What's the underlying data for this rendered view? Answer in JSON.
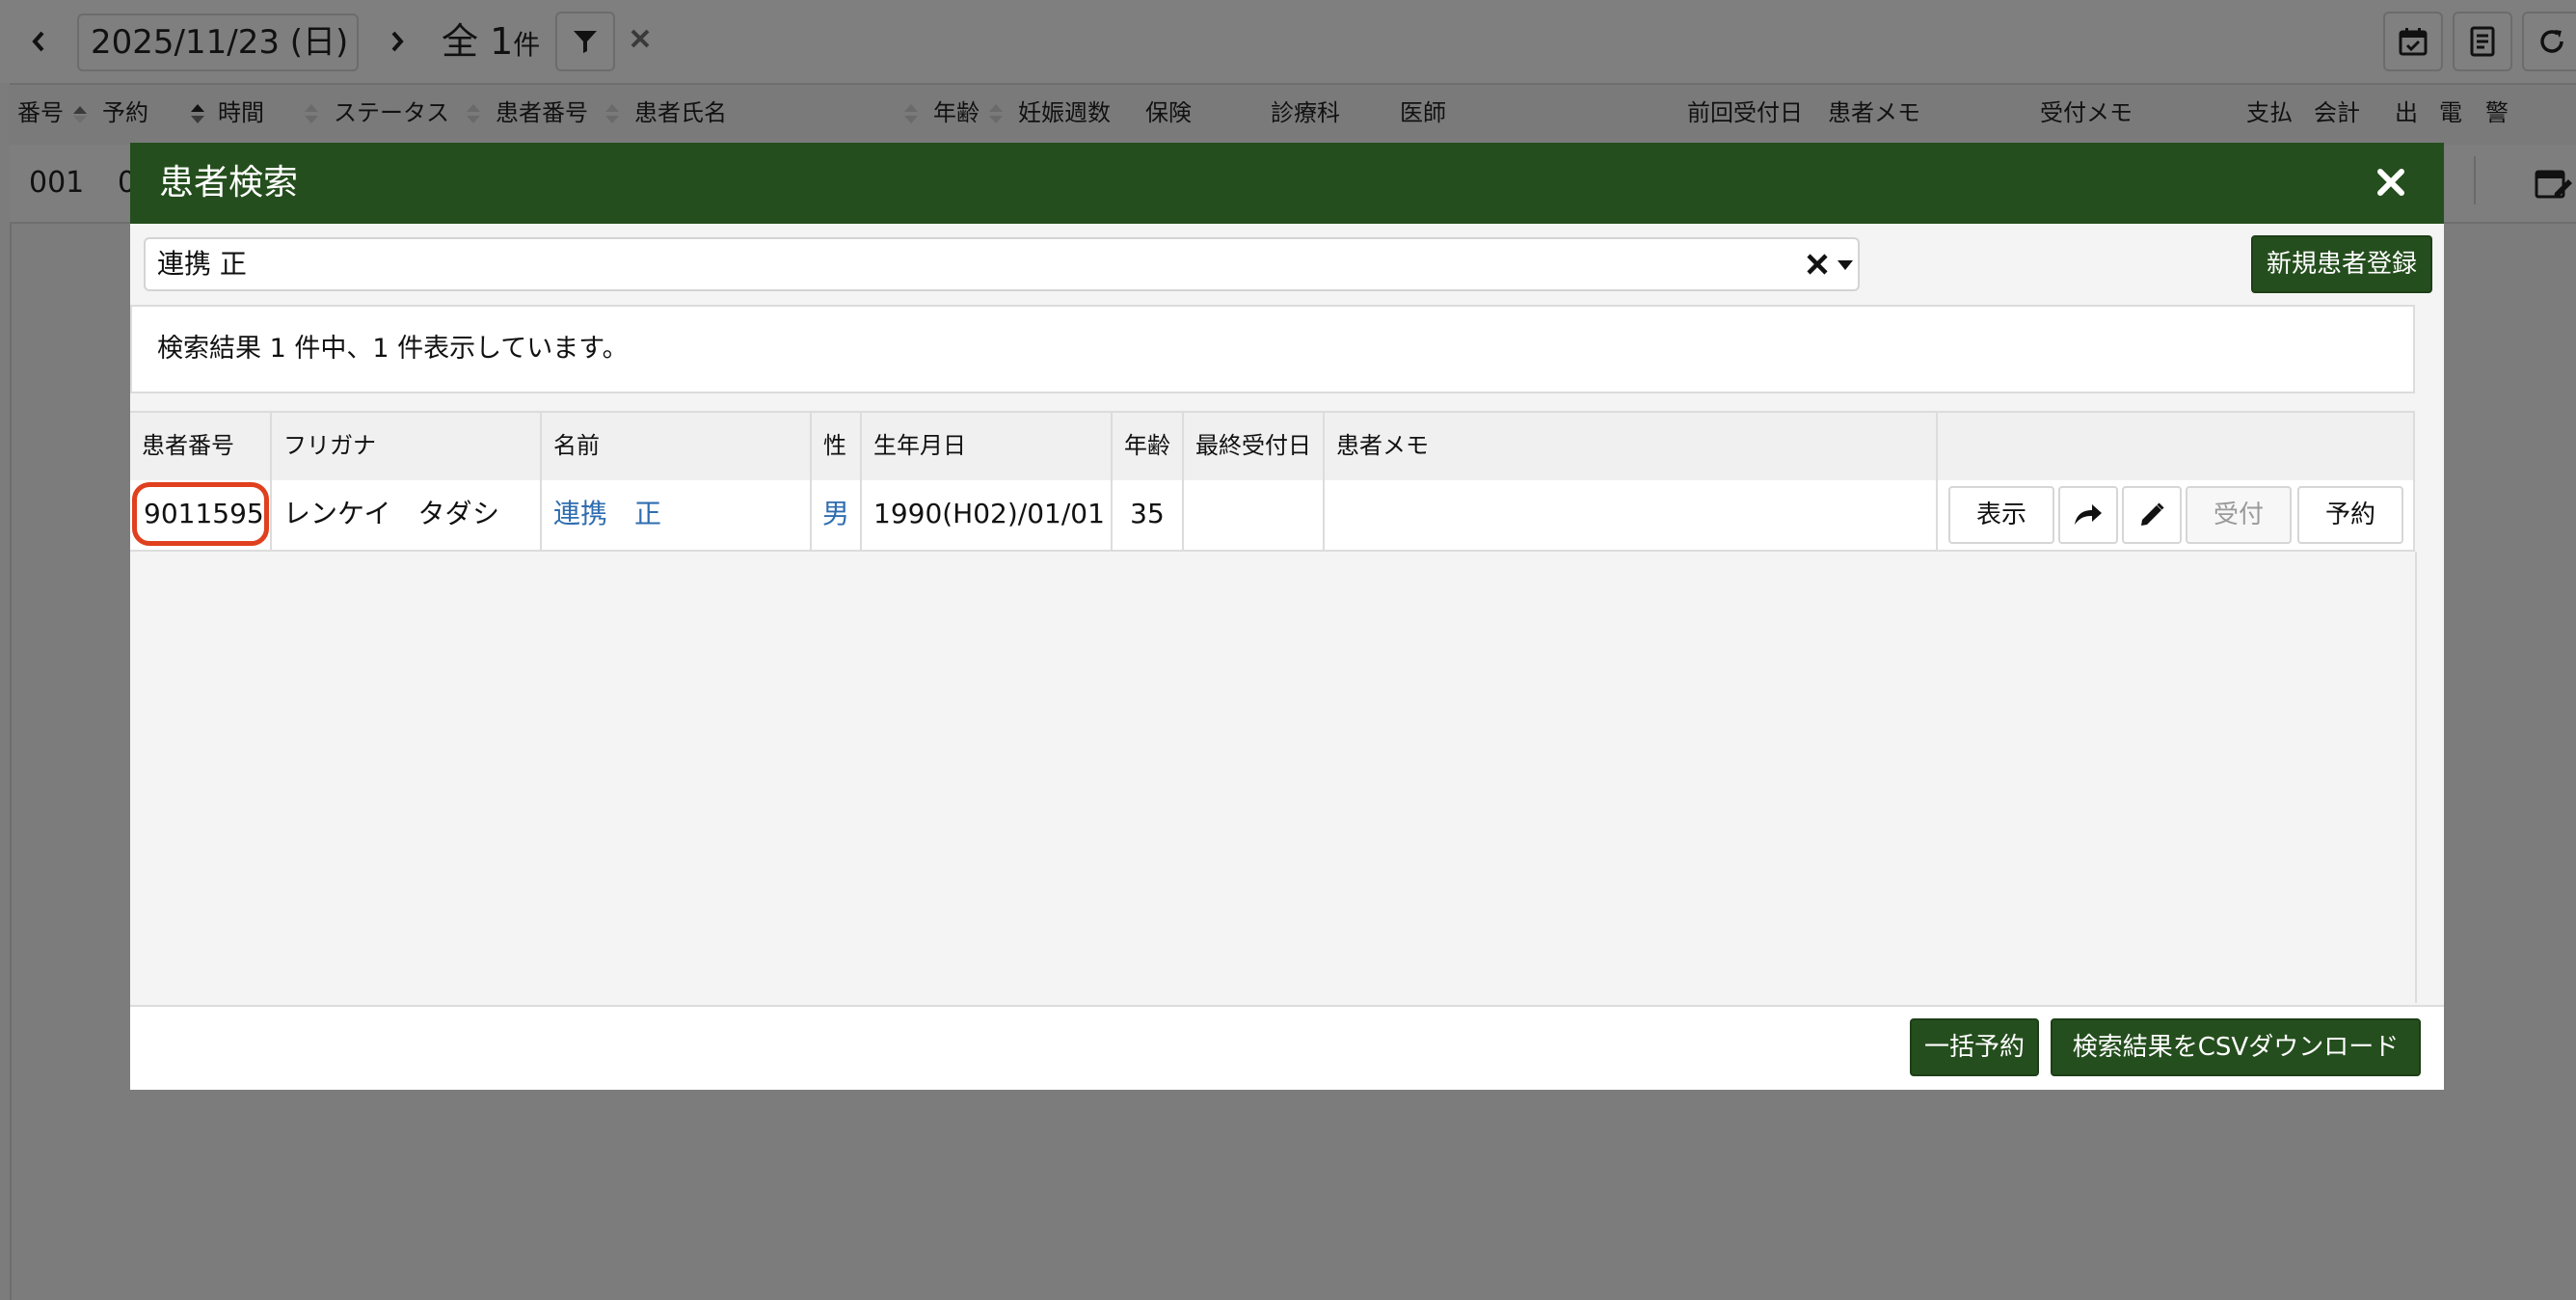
{
  "app": {
    "date": "2025/11/23 (日)",
    "total_prefix": "全",
    "total_count": "1",
    "total_unit": "件",
    "columns": [
      "番号",
      "予約",
      "時間",
      "ステータス",
      "患者番号",
      "患者氏名",
      "年齢",
      "妊娠週数",
      "保険",
      "診療科",
      "医師",
      "前回受付日",
      "患者メモ",
      "受付メモ",
      "支払",
      "会計",
      "出",
      "電",
      "警"
    ],
    "row": {
      "number": "001",
      "second_cell": "0"
    },
    "colors": {
      "overlay_bg": "#7c7c7c",
      "brand_green": "#254e1e",
      "link_blue": "#2f6db0",
      "highlight_red": "#e0401e"
    }
  },
  "modal": {
    "title": "患者検索",
    "search": {
      "value": "連携 正"
    },
    "new_patient_label": "新規患者登録",
    "result_text": "検索結果 1 件中、1 件表示しています。",
    "table": {
      "headers": [
        "患者番号",
        "フリガナ",
        "名前",
        "性",
        "生年月日",
        "年齢",
        "最終受付日",
        "患者メモ",
        ""
      ],
      "rows": [
        {
          "patient_no": "9011595",
          "kana": "レンケイ　タダシ",
          "name": "連携　正",
          "sex": "男",
          "birth": "1990(H02)/01/01",
          "age": "35",
          "last_visit": "",
          "memo": ""
        }
      ],
      "row_buttons": {
        "view": "表示",
        "reception": "受付",
        "reserve": "予約"
      }
    },
    "footer": {
      "bulk_reserve": "一括予約",
      "csv_download": "検索結果をCSVダウンロード"
    }
  }
}
